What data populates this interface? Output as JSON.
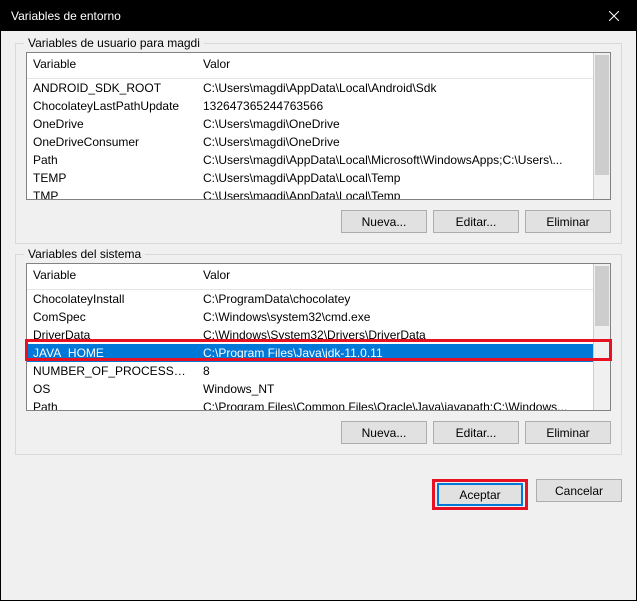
{
  "window": {
    "title": "Variables de entorno"
  },
  "userVars": {
    "title": "Variables de usuario para magdi",
    "columns": {
      "variable": "Variable",
      "value": "Valor"
    },
    "rows": [
      {
        "variable": "ANDROID_SDK_ROOT",
        "value": "C:\\Users\\magdi\\AppData\\Local\\Android\\Sdk"
      },
      {
        "variable": "ChocolateyLastPathUpdate",
        "value": "132647365244763566"
      },
      {
        "variable": "OneDrive",
        "value": "C:\\Users\\magdi\\OneDrive"
      },
      {
        "variable": "OneDriveConsumer",
        "value": "C:\\Users\\magdi\\OneDrive"
      },
      {
        "variable": "Path",
        "value": "C:\\Users\\magdi\\AppData\\Local\\Microsoft\\WindowsApps;C:\\Users\\..."
      },
      {
        "variable": "TEMP",
        "value": "C:\\Users\\magdi\\AppData\\Local\\Temp"
      },
      {
        "variable": "TMP",
        "value": "C:\\Users\\magdi\\AppData\\Local\\Temp"
      }
    ],
    "buttons": {
      "new": "Nueva...",
      "edit": "Editar...",
      "delete": "Eliminar"
    }
  },
  "sysVars": {
    "title": "Variables del sistema",
    "columns": {
      "variable": "Variable",
      "value": "Valor"
    },
    "rows": [
      {
        "variable": "ChocolateyInstall",
        "value": "C:\\ProgramData\\chocolatey"
      },
      {
        "variable": "ComSpec",
        "value": "C:\\Windows\\system32\\cmd.exe"
      },
      {
        "variable": "DriverData",
        "value": "C:\\Windows\\System32\\Drivers\\DriverData"
      },
      {
        "variable": "JAVA_HOME",
        "value": "C:\\Program Files\\Java\\jdk-11.0.11",
        "selected": true
      },
      {
        "variable": "NUMBER_OF_PROCESSORS",
        "value": "8"
      },
      {
        "variable": "OS",
        "value": "Windows_NT"
      },
      {
        "variable": "Path",
        "value": "C:\\Program Files\\Common Files\\Oracle\\Java\\javapath;C:\\Windows..."
      }
    ],
    "buttons": {
      "new": "Nueva...",
      "edit": "Editar...",
      "delete": "Eliminar"
    }
  },
  "footer": {
    "ok": "Aceptar",
    "cancel": "Cancelar"
  }
}
